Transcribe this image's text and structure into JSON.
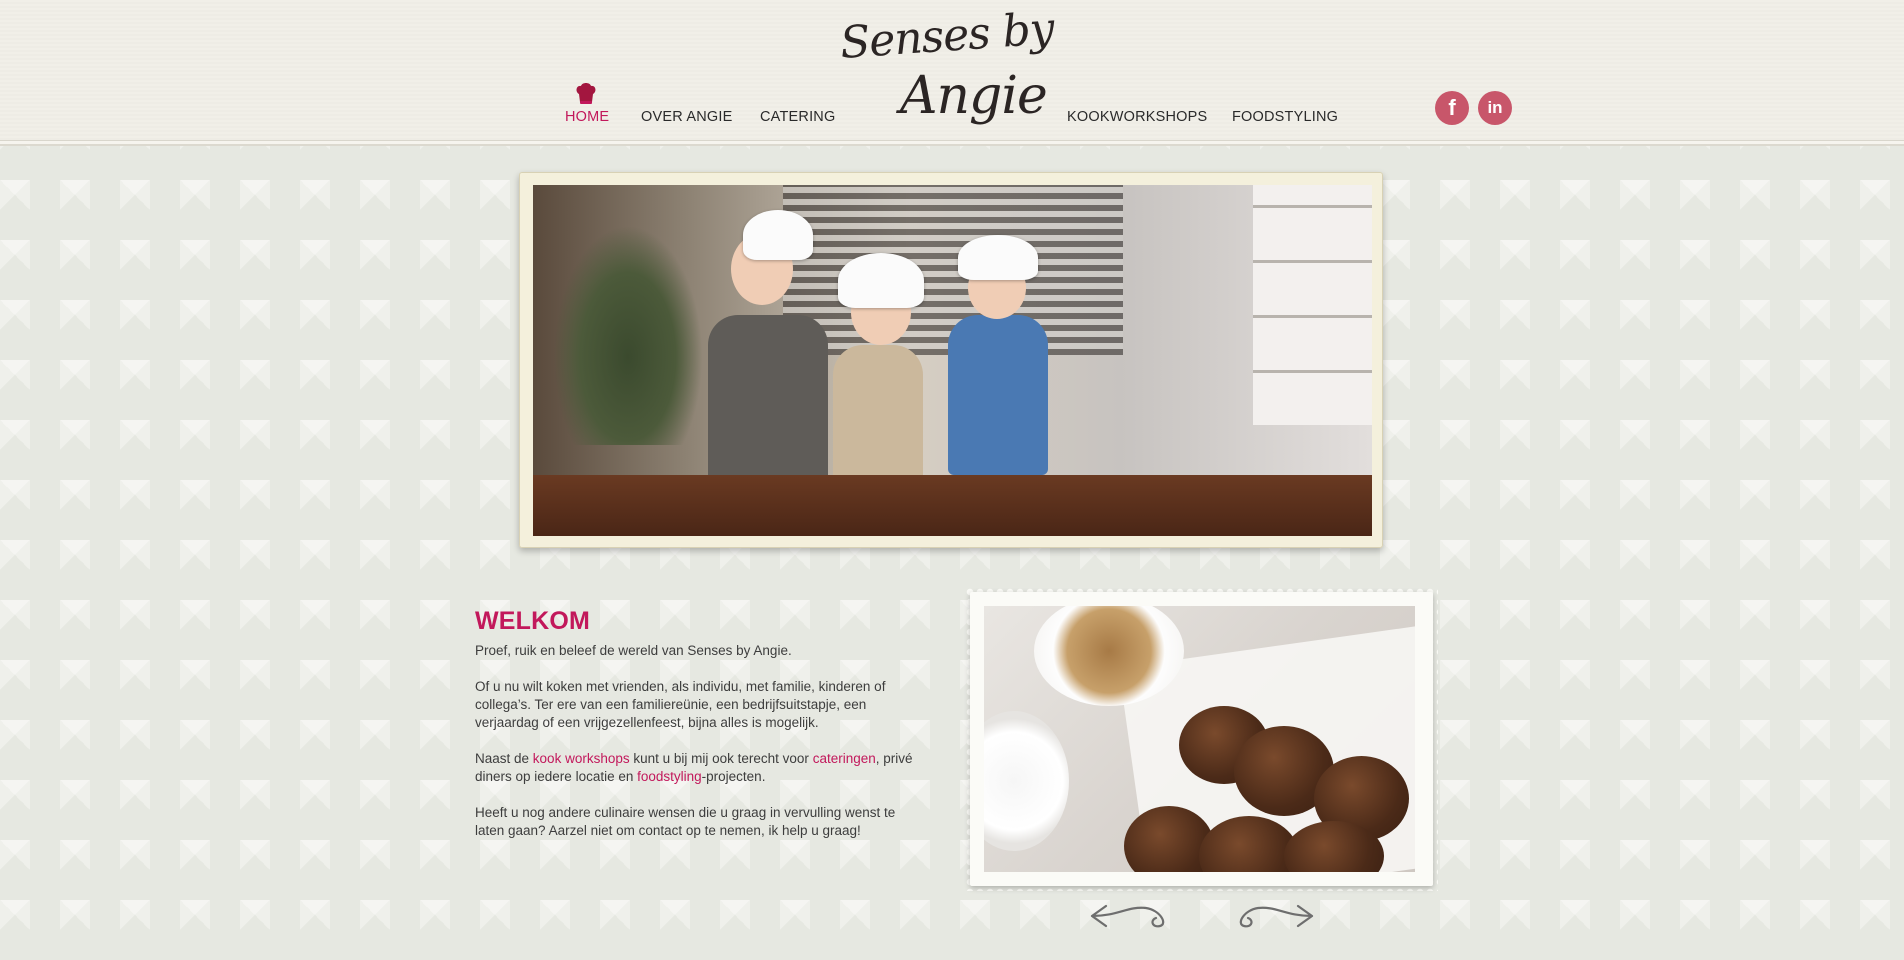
{
  "header": {
    "logo_line1": "Senses by",
    "logo_line2": "Angie",
    "nav": {
      "home": "HOME",
      "over_angie": "OVER ANGIE",
      "catering": "CATERING",
      "kookworkshops": "KOOKWORKSHOPS",
      "foodstyling": "FOODSTYLING"
    },
    "social": {
      "facebook": "f",
      "linkedin": "in"
    }
  },
  "welcome": {
    "title": "WELKOM",
    "p1": "Proef, ruik en beleef de wereld van Senses by Angie.",
    "p2": "Of u nu wilt koken met vrienden, als individu, met familie, kinderen of collega’s. Ter ere van een familiereünie, een bedrijfsuitstapje, een verjaardag of een vrijgezellenfeest, bijna alles is mogelijk.",
    "p3_a": "Naast de ",
    "p3_link1": "kook workshops",
    "p3_b": " kunt u bij mij ook terecht voor ",
    "p3_link2": "cateringen",
    "p3_c": ", privé diners op iedere locatie en ",
    "p3_link3": "foodstyling",
    "p3_d": "-projecten.",
    "p4": "Heeft u nog andere culinaire wensen die u graag in vervulling wenst te laten gaan? Aarzel niet om contact op te nemen, ik help u graag!"
  },
  "colors": {
    "accent": "#c2185b",
    "social": "#c8566a",
    "text": "#3d3d3d"
  },
  "icons": {
    "nav_active": "chef-hat-icon",
    "prev": "arrow-left-icon",
    "next": "arrow-right-icon"
  }
}
